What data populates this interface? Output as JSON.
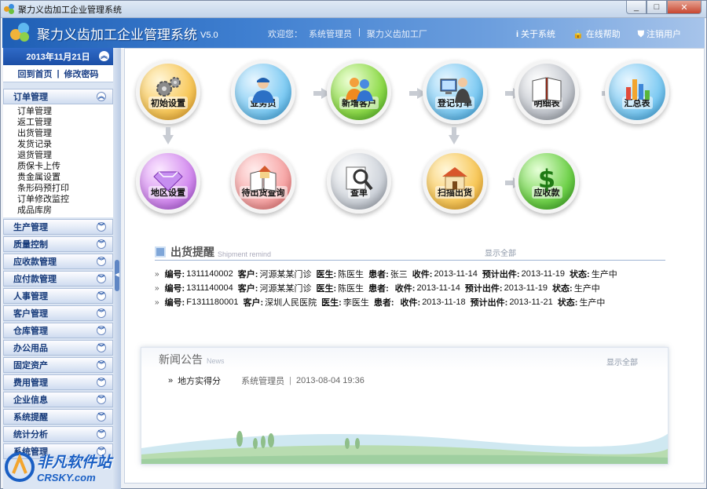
{
  "window": {
    "title": "聚力义齿加工企业管理系统",
    "btn_min": "_",
    "btn_max": "□",
    "btn_close": "✕"
  },
  "header": {
    "system_name": "聚力义齿加工企业管理系统",
    "version": "V5.0",
    "welcome": "欢迎您：",
    "user": "系统管理员",
    "sep": "|",
    "company": "聚力义齿加工厂",
    "links": [
      {
        "icon": "i",
        "label": "关于系统"
      },
      {
        "icon": "🔒",
        "label": "在线帮助"
      },
      {
        "icon": "⛊",
        "label": "注销用户"
      }
    ]
  },
  "sidebar": {
    "date": "2013年11月21日",
    "quick_home": "回到首页",
    "quick_sep": "|",
    "quick_pwd": "修改密码",
    "open_group": {
      "label": "订单管理",
      "items": [
        "订单管理",
        "返工管理",
        "出货管理",
        "发货记录",
        "退货管理",
        "质保卡上传",
        "贵金属设置",
        "条形码预打印",
        "订单修改监控",
        "成品库房"
      ]
    },
    "groups": [
      "生产管理",
      "质量控制",
      "应收款管理",
      "应付款管理",
      "人事管理",
      "客户管理",
      "仓库管理",
      "办公用品",
      "固定资产",
      "费用管理",
      "企业信息",
      "系统提醒",
      "统计分析",
      "系统管理"
    ]
  },
  "flow": {
    "row1": [
      "初始设置",
      "业务员",
      "新增客户",
      "登记订单",
      "明细表",
      "汇总表"
    ],
    "row2": [
      "地区设置",
      "待出货查询",
      "查单",
      "扫描出货",
      "应收款"
    ]
  },
  "shipment": {
    "title": "出货提醒",
    "subtitle": "Shipment remind",
    "show_all": "显示全部",
    "labels": {
      "no": "编号:",
      "client": "客户:",
      "doctor": "医生:",
      "patient": "患者:",
      "recv": "收件:",
      "due": "预计出件:",
      "status": "状态:"
    },
    "rows": [
      {
        "no": "1311140002",
        "client": "河源某某门诊",
        "doctor": "陈医生",
        "patient": "张三",
        "recv": "2013-11-14",
        "due": "2013-11-19",
        "status": "生产中"
      },
      {
        "no": "1311140004",
        "client": "河源某某门诊",
        "doctor": "陈医生",
        "patient": "",
        "recv": "2013-11-14",
        "due": "2013-11-19",
        "status": "生产中"
      },
      {
        "no": "F1311180001",
        "client": "深圳人民医院",
        "doctor": "李医生",
        "patient": "",
        "recv": "2013-11-18",
        "due": "2013-11-21",
        "status": "生产中"
      }
    ]
  },
  "news": {
    "title": "新闻公告",
    "subtitle": "News",
    "show_all": "显示全部",
    "items": [
      {
        "title": "地方实得分",
        "author": "系统管理员",
        "sep": "|",
        "date": "2013-08-04 19:36"
      }
    ]
  },
  "watermark": {
    "line1": "非凡软件站",
    "line2": "CRSKY.com"
  },
  "colors": {
    "header_start": "#1f5fb5",
    "accent": "#1c4fa6"
  }
}
